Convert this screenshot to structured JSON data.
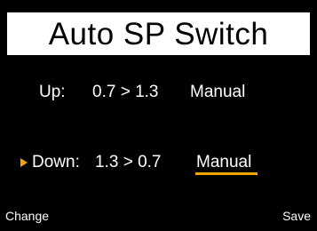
{
  "title": "Auto SP Switch",
  "rows": [
    {
      "label": "Up:",
      "range": "0.7 > 1.3",
      "mode": "Manual"
    },
    {
      "label": "Down:",
      "range": "1.3 > 0.7",
      "mode": "Manual"
    }
  ],
  "cursor": {
    "row": "Down",
    "icon": "triangle-right-icon"
  },
  "softkeys": {
    "left": "Change",
    "right": "Save"
  },
  "colors": {
    "accent": "#f0a500",
    "background": "#000000",
    "text": "#ffffff",
    "title_bg": "#ffffff",
    "title_text": "#000000"
  }
}
